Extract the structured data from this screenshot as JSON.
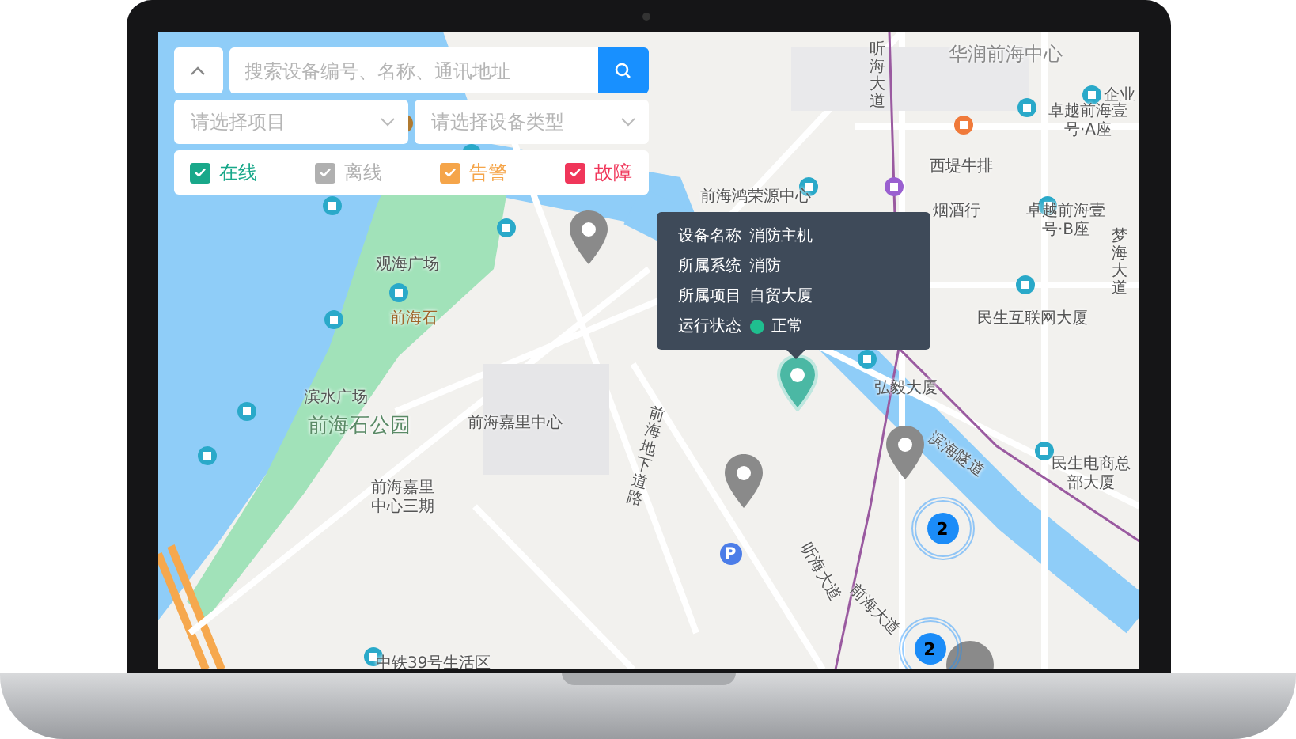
{
  "panel": {
    "search": {
      "placeholder": "搜索设备编号、名称、通讯地址"
    },
    "filters": [
      {
        "placeholder": "请选择项目"
      },
      {
        "placeholder": "请选择设备类型"
      }
    ],
    "statuses": [
      {
        "label": "在线",
        "checked": true,
        "color": "#19a88a"
      },
      {
        "label": "离线",
        "checked": true,
        "color": "#b0b0b0"
      },
      {
        "label": "告警",
        "checked": true,
        "color": "#f5a54a"
      },
      {
        "label": "故障",
        "checked": true,
        "color": "#f0365a"
      }
    ]
  },
  "tooltip": {
    "rows": [
      {
        "label": "设备名称",
        "value": "消防主机"
      },
      {
        "label": "所属系统",
        "value": "消防"
      },
      {
        "label": "所属项目",
        "value": "自贸大厦"
      },
      {
        "label": "运行状态",
        "value": "正常",
        "color": "#1fbf8f"
      }
    ]
  },
  "map": {
    "labels": [
      "华润前海中心",
      "企业",
      "卓越前海壹号·A座",
      "西堤牛排",
      "卓越前海壹号·B座",
      "前海鸿荣源中心",
      "烟酒行",
      "听海大道",
      "梦海大道",
      "民生互联网大厦",
      "弘毅大厦",
      "滨海隧道",
      "民生电商总部大厦",
      "观海广场",
      "前海石",
      "滨水广场",
      "前海石公园",
      "前海嘉里中心",
      "前海嘉里中心三期",
      "前海地下道路",
      "听海大道",
      "前海大道",
      "中铁39号生活区"
    ],
    "markers": [
      {
        "kind": "pin",
        "color": "#8a8a8a",
        "selected": false
      },
      {
        "kind": "pin",
        "color": "#8a8a8a",
        "selected": false
      },
      {
        "kind": "pin",
        "color": "#8a8a8a",
        "selected": false
      },
      {
        "kind": "pin",
        "color": "#4bb8a4",
        "selected": true
      },
      {
        "kind": "blob",
        "color": "#8a8a8a"
      },
      {
        "kind": "cluster",
        "count": "2"
      },
      {
        "kind": "cluster",
        "count": "2"
      },
      {
        "kind": "parking",
        "text": "P"
      }
    ]
  }
}
